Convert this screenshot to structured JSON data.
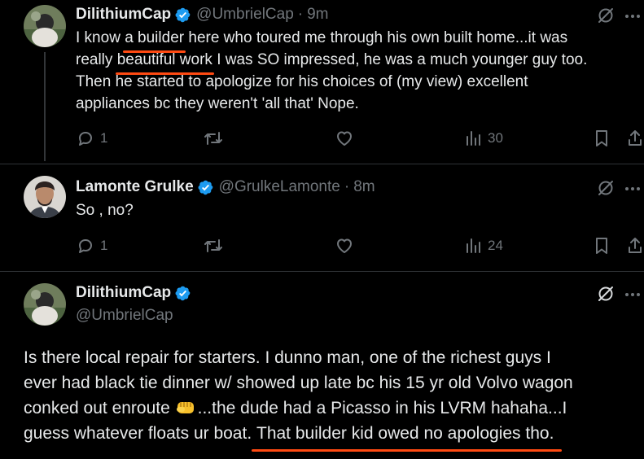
{
  "tweets": [
    {
      "display_name": "DilithiumCap",
      "handle": "@UmbrielCap",
      "time": "9m",
      "lines": [
        [
          "I know ",
          "a builder",
          " here who toured me through his own built home...it was"
        ],
        [
          "really ",
          "beautiful work",
          " I was SO impressed, he was a much younger guy too."
        ],
        [
          "Then he started to apologize for his choices of (my view) excellent"
        ],
        [
          "appliances bc they weren't 'all that' Nope."
        ]
      ],
      "replies": "1",
      "views": "30"
    },
    {
      "display_name": "Lamonte Grulke",
      "handle": "@GrulkeLamonte",
      "time": "8m",
      "text": "So , no?",
      "replies": "1",
      "views": "24"
    },
    {
      "display_name": "DilithiumCap",
      "handle": "@UmbrielCap",
      "lines": [
        "Is there local repair for starters. I dunno man, one of the richest guys I",
        "ever had black tie dinner w/ showed up late bc his 15 yr old Volvo wagon",
        "...the dude had a Picasso in his LVRM hahaha...I",
        "guess whatever floats ur boat. ",
        "That builder kid owed no apologies tho."
      ],
      "line3_prefix": "conked out enroute "
    }
  ],
  "icons": {
    "verified": "verified-badge-icon",
    "grok": "grok-icon",
    "more": "more-icon",
    "reply": "reply-icon",
    "retweet": "retweet-icon",
    "like": "like-icon",
    "views": "views-icon",
    "bookmark": "bookmark-icon",
    "share": "share-icon",
    "emoji": "fist-emoji"
  },
  "colors": {
    "background": "#000000",
    "text": "#e7e9ea",
    "muted": "#71767b",
    "verified": "#1d9bf0",
    "highlight_underline": "#ff4a12"
  }
}
